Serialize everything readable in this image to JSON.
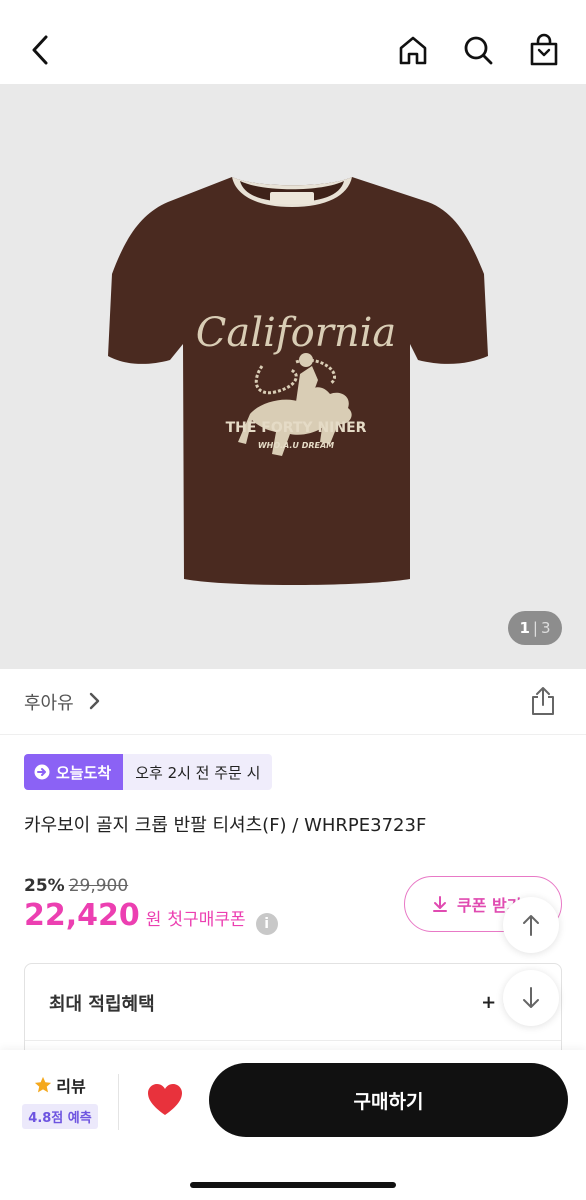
{
  "header": {
    "back_icon": "chevron-left-icon",
    "home_icon": "home-icon",
    "search_icon": "search-icon",
    "cart_icon": "shopping-bag-icon"
  },
  "hero": {
    "image_counter": {
      "current": "1",
      "separator": "|",
      "total": "3"
    },
    "print_text": {
      "script_word": "California",
      "line1": "THE FORTY NINER",
      "line2": "WHO.A.U DREAM"
    },
    "tshirt_color": "#4a2a20",
    "background_color": "#e9e9e9"
  },
  "brand": {
    "name": "후아유",
    "chevron_icon": "chevron-right-icon",
    "share_icon": "share-icon"
  },
  "delivery": {
    "today_label": "오늘도착",
    "time_label": "오후 2시 전 주문 시"
  },
  "product": {
    "title": "카우보이 골지 크롭 반팔 티셔츠(F) / WHRPE3723F"
  },
  "pricing": {
    "discount": "25%",
    "original_price": "29,900",
    "price": "22,420",
    "currency": "원",
    "first_purchase_coupon": "첫구매쿠폰",
    "info_icon": "info-icon",
    "coupon_button": "쿠폰 받기",
    "accent_color": "#ec3fb1"
  },
  "reward": {
    "label": "최대 적립혜택",
    "value": "+ 6"
  },
  "float_buttons": {
    "up_icon": "arrow-up-icon",
    "down_icon": "arrow-down-icon"
  },
  "bottom_bar": {
    "review_label": "리뷰",
    "review_badge": "4.8점 예측",
    "star_icon": "star-icon",
    "heart_icon": "heart-icon",
    "buy_button": "구매하기"
  }
}
